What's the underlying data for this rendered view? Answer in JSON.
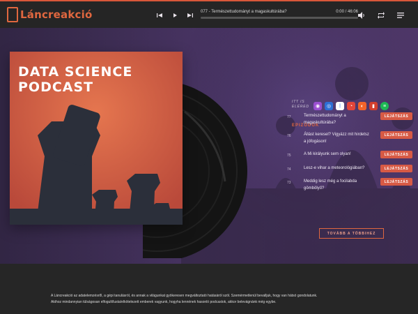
{
  "brand": {
    "name": "Láncreakció"
  },
  "player": {
    "episode": "077 - Természettudományt a magaskultúrába?",
    "time_current": "0:00",
    "time_total": "46:06",
    "progress_fraction": 0.0
  },
  "cover": {
    "title_line1": "DATA SCIENCE",
    "title_line2": "PODCAST"
  },
  "available": {
    "line1": "ITT IS",
    "line2": "ELÉRED"
  },
  "platform_icons": [
    "podcast-icon",
    "safari-icon",
    "google-podcasts-icon",
    "pocketcasts-icon",
    "castbox-icon",
    "stitcher-icon",
    "spotify-icon"
  ],
  "episodes_title": "EPIZÓDOK",
  "episodes": [
    {
      "no": "77",
      "title": "Természettudományt a magaskultúrába?",
      "button": "LEJÁTSZÁS"
    },
    {
      "no": "76",
      "title": "Állást keresel? Vigyázz mit hirdetsz a jófogáson!",
      "button": "LEJÁTSZÁS"
    },
    {
      "no": "75",
      "title": "A Mi királyunk sem olyan!",
      "button": "LEJÁTSZÁS"
    },
    {
      "no": "74",
      "title": "Lesz-e vihar a meteorológiában?",
      "button": "LEJÁTSZÁS"
    },
    {
      "no": "73",
      "title": "Meddig lesz még a focilabda gömbölyű?",
      "button": "LEJÁTSZÁS"
    }
  ],
  "more_button": "TOVÁBB A TÖBBIHEZ",
  "footer": {
    "line1": "A Láncreakció az adatelemzésről, a gépi tanulásról, és annak a világunkat gyökeresen megváltoztató hatásáról szól. Szemérmetlenül bevalljuk, hogy van hátsó gondolatunk.",
    "line2": "Akihoz mindannyian túlságosan elfogult/lusta/elkötelezett emberek vagyunk, hogyha lennének hasonló podcastok, akkor belevágnánk még egybe."
  },
  "colors": {
    "accent": "#e0673f",
    "button": "#d75a45",
    "hero_bg": "#493464"
  }
}
